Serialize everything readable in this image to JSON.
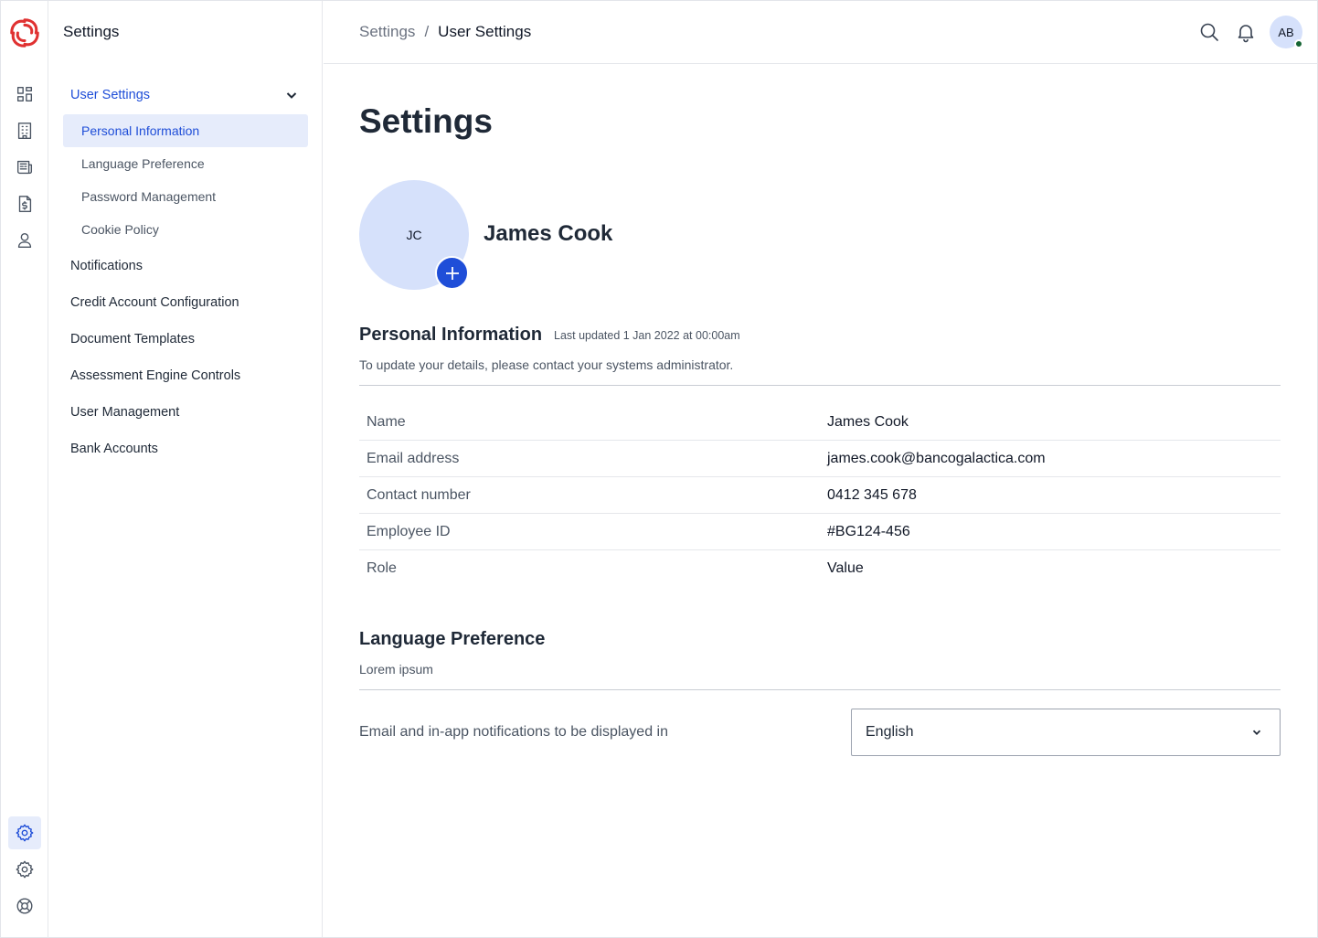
{
  "app": {
    "section_title": "Settings"
  },
  "breadcrumb": {
    "parent": "Settings",
    "separator": "/",
    "current": "User Settings"
  },
  "header": {
    "avatar_initials": "AB",
    "icons": [
      "search-icon",
      "bell-icon"
    ]
  },
  "rail": {
    "icons": [
      "dashboard-icon",
      "building-icon",
      "newspaper-icon",
      "invoice-dollar-icon",
      "user-icon",
      "gear-icon",
      "gear-icon",
      "lifebuoy-icon"
    ],
    "active": "gear-icon"
  },
  "subnav": {
    "group_label": "User Settings",
    "sub_items": [
      {
        "label": "Personal Information",
        "active": true
      },
      {
        "label": "Language Preference",
        "active": false
      },
      {
        "label": "Password Management",
        "active": false
      },
      {
        "label": "Cookie Policy",
        "active": false
      }
    ],
    "items": [
      "Notifications",
      "Credit Account Configuration",
      "Document Templates",
      "Assessment Engine Controls",
      "User Management",
      "Bank Accounts"
    ]
  },
  "main": {
    "title": "Settings",
    "profile": {
      "initials": "JC",
      "name": "James Cook"
    },
    "personal": {
      "title": "Personal Information",
      "last_updated": "Last updated 1 Jan 2022 at 00:00am",
      "description": "To update your details, please contact your systems administrator.",
      "rows": [
        {
          "label": "Name",
          "value": "James Cook"
        },
        {
          "label": "Email address",
          "value": "james.cook@bancogalactica.com"
        },
        {
          "label": "Contact number",
          "value": "0412 345 678"
        },
        {
          "label": "Employee ID",
          "value": "#BG124-456"
        },
        {
          "label": "Role",
          "value": "Value"
        }
      ]
    },
    "language": {
      "title": "Language Preference",
      "description": "Lorem ipsum",
      "field_label": "Email and in-app notifications to be displayed in",
      "selected": "English"
    }
  },
  "colors": {
    "accent": "#1f4ed8",
    "accent_light": "#e6ecfb",
    "avatar_bg": "#d6e1fb",
    "online": "#166534"
  }
}
